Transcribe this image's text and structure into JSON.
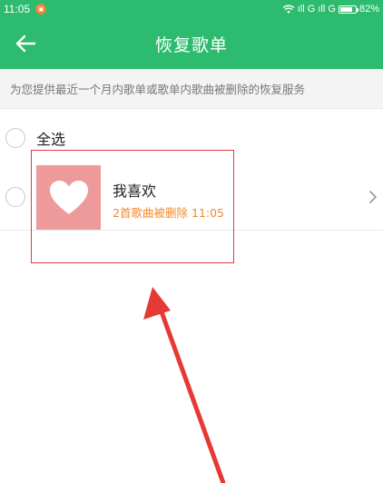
{
  "status_bar": {
    "time": "11:05",
    "signal_text": "ıll G ıll G",
    "battery_percent": 82,
    "battery_label": "82%"
  },
  "app_bar": {
    "title": "恢复歌单",
    "back_icon": "arrow-left-icon"
  },
  "banner": {
    "text": "为您提供最近一个月内歌单或歌单内歌曲被删除的恢复服务"
  },
  "select_all": {
    "label": "全选",
    "checked": false
  },
  "playlists": [
    {
      "name": "我喜欢",
      "deleted_info": "2首歌曲被删除",
      "time": "11:05",
      "cover_icon": "heart-icon",
      "checked": false
    }
  ],
  "colors": {
    "primary": "#2dbb6f",
    "accent_orange": "#f08a2a",
    "cover_pink": "#ef9a9a",
    "annotation_red": "#e53935"
  }
}
